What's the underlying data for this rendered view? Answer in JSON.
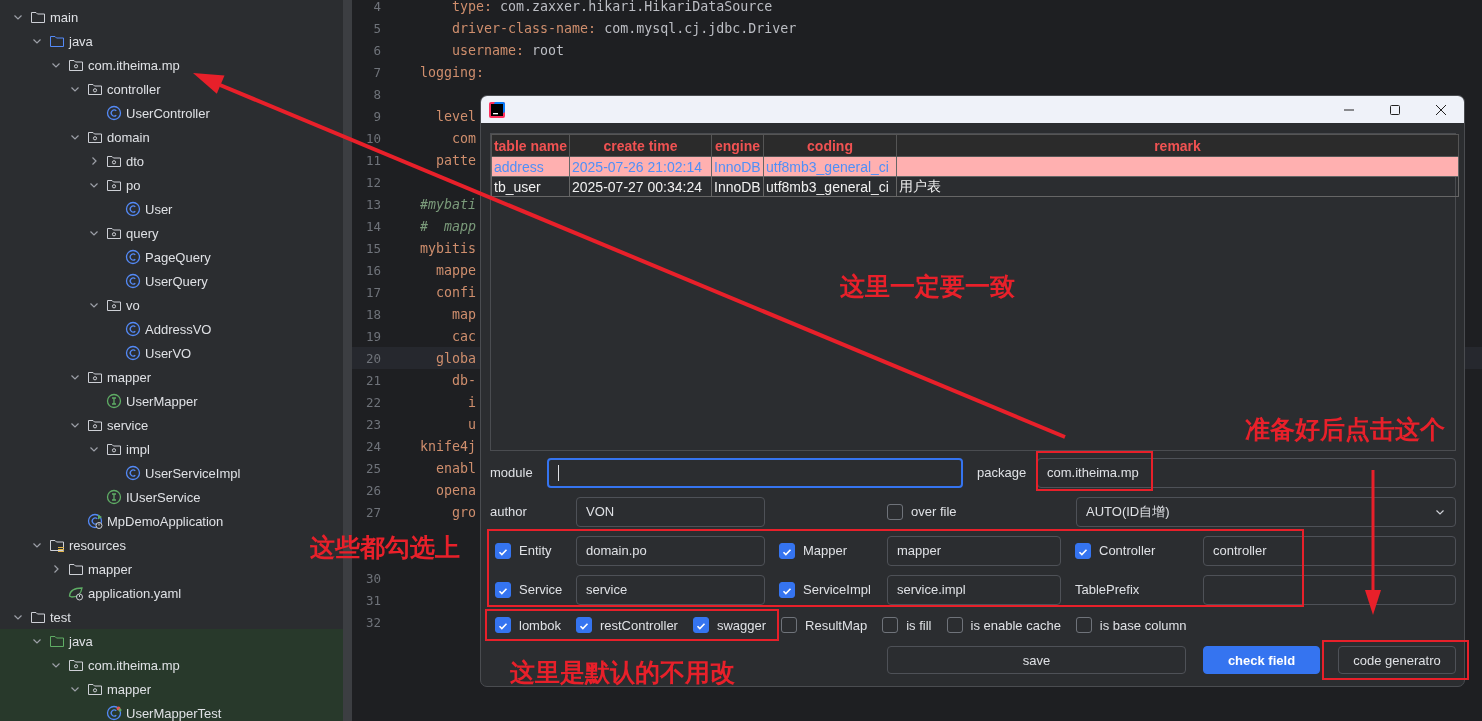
{
  "project_tree": [
    {
      "label": "main",
      "kind": "folder",
      "expanded": true,
      "highlighted": false,
      "children": [
        {
          "label": "java",
          "kind": "source-folder",
          "expanded": true,
          "highlighted": false,
          "children": [
            {
              "label": "com.itheima.mp",
              "kind": "package",
              "expanded": true,
              "highlighted": false,
              "children": [
                {
                  "label": "controller",
                  "kind": "package",
                  "expanded": true,
                  "highlighted": false,
                  "children": [
                    {
                      "label": "UserController",
                      "kind": "class",
                      "highlighted": false
                    }
                  ]
                },
                {
                  "label": "domain",
                  "kind": "package",
                  "expanded": true,
                  "highlighted": false,
                  "children": [
                    {
                      "label": "dto",
                      "kind": "package",
                      "expanded": false,
                      "highlighted": false
                    },
                    {
                      "label": "po",
                      "kind": "package",
                      "expanded": true,
                      "highlighted": false,
                      "children": [
                        {
                          "label": "User",
                          "kind": "class",
                          "highlighted": false
                        }
                      ]
                    },
                    {
                      "label": "query",
                      "kind": "package",
                      "expanded": true,
                      "highlighted": false,
                      "children": [
                        {
                          "label": "PageQuery",
                          "kind": "class",
                          "highlighted": false
                        },
                        {
                          "label": "UserQuery",
                          "kind": "class",
                          "highlighted": false
                        }
                      ]
                    },
                    {
                      "label": "vo",
                      "kind": "package",
                      "expanded": true,
                      "highlighted": false,
                      "children": [
                        {
                          "label": "AddressVO",
                          "kind": "class",
                          "highlighted": false
                        },
                        {
                          "label": "UserVO",
                          "kind": "class",
                          "highlighted": false
                        }
                      ]
                    }
                  ]
                },
                {
                  "label": "mapper",
                  "kind": "package",
                  "expanded": true,
                  "highlighted": false,
                  "children": [
                    {
                      "label": "UserMapper",
                      "kind": "interface",
                      "highlighted": false
                    }
                  ]
                },
                {
                  "label": "service",
                  "kind": "package",
                  "expanded": true,
                  "highlighted": false,
                  "children": [
                    {
                      "label": "impl",
                      "kind": "package",
                      "expanded": true,
                      "highlighted": false,
                      "children": [
                        {
                          "label": "UserServiceImpl",
                          "kind": "class",
                          "highlighted": false
                        }
                      ]
                    },
                    {
                      "label": "IUserService",
                      "kind": "interface",
                      "highlighted": false
                    }
                  ]
                },
                {
                  "label": "MpDemoApplication",
                  "kind": "app",
                  "highlighted": false
                }
              ]
            }
          ]
        },
        {
          "label": "resources",
          "kind": "resources",
          "expanded": true,
          "highlighted": false,
          "children": [
            {
              "label": "mapper",
              "kind": "folder",
              "expanded": false,
              "highlighted": false
            },
            {
              "label": "application.yaml",
              "kind": "yaml",
              "highlighted": false
            }
          ]
        }
      ]
    },
    {
      "label": "test",
      "kind": "folder",
      "expanded": true,
      "highlighted": false,
      "children": [
        {
          "label": "java",
          "kind": "test-source-folder",
          "expanded": true,
          "highlighted": true,
          "children": [
            {
              "label": "com.itheima.mp",
              "kind": "package",
              "expanded": true,
              "highlighted": true,
              "children": [
                {
                  "label": "mapper",
                  "kind": "package",
                  "expanded": true,
                  "highlighted": true,
                  "children": [
                    {
                      "label": "UserMapperTest",
                      "kind": "test-class",
                      "highlighted": true
                    }
                  ]
                }
              ]
            }
          ]
        }
      ]
    }
  ],
  "editor": {
    "lines": [
      {
        "number": "4",
        "kind": "code",
        "key": "    type:",
        "value": " com.zaxxer.hikari.HikariDataSource",
        "current": false
      },
      {
        "number": "5",
        "kind": "code",
        "key": "    driver-class-name:",
        "value": " com.mysql.cj.jdbc.Driver",
        "current": false
      },
      {
        "number": "6",
        "kind": "code",
        "key": "    username:",
        "value": " root",
        "current": false
      },
      {
        "number": "7",
        "kind": "code",
        "key": "logging:",
        "current": false
      },
      {
        "number": "8",
        "kind": "blank",
        "current": false
      },
      {
        "number": "9",
        "kind": "code",
        "key": "  level",
        "current": false
      },
      {
        "number": "10",
        "kind": "code",
        "key": "    com",
        "current": false
      },
      {
        "number": "11",
        "kind": "code",
        "key": "  patte",
        "current": false
      },
      {
        "number": "12",
        "kind": "blank",
        "current": false
      },
      {
        "number": "13",
        "kind": "comment",
        "key": "#mybati",
        "current": false
      },
      {
        "number": "14",
        "kind": "comment",
        "key": "#  mapp",
        "current": false
      },
      {
        "number": "15",
        "kind": "code",
        "key": "mybitis",
        "current": false
      },
      {
        "number": "16",
        "kind": "code",
        "key": "  mappe",
        "current": false
      },
      {
        "number": "17",
        "kind": "code",
        "key": "  confi",
        "current": false
      },
      {
        "number": "18",
        "kind": "code",
        "key": "    map",
        "current": false
      },
      {
        "number": "19",
        "kind": "code",
        "key": "    cac",
        "current": false
      },
      {
        "number": "20",
        "kind": "code",
        "key": "  globa",
        "current": true
      },
      {
        "number": "21",
        "kind": "code",
        "key": "    db-",
        "current": false
      },
      {
        "number": "22",
        "kind": "code",
        "key": "      i",
        "current": false
      },
      {
        "number": "23",
        "kind": "code",
        "key": "      u",
        "current": false
      },
      {
        "number": "24",
        "kind": "code",
        "key": "knife4j",
        "current": false
      },
      {
        "number": "25",
        "kind": "code",
        "key": "  enabl",
        "current": false
      },
      {
        "number": "26",
        "kind": "code",
        "key": "  opena",
        "current": false
      },
      {
        "number": "27",
        "kind": "code",
        "key": "    gro",
        "current": false
      },
      {
        "kind": "blank",
        "current": false
      },
      {
        "kind": "blank",
        "current": false
      },
      {
        "number": "30",
        "kind": "blank",
        "current": false
      },
      {
        "number": "31",
        "kind": "blank",
        "current": false
      },
      {
        "number": "32",
        "kind": "blank",
        "current": false
      }
    ]
  },
  "dialog": {
    "table": {
      "columns": [
        "table name",
        "create time",
        "engine",
        "coding",
        "remark"
      ],
      "rows": [
        {
          "cells": [
            "address",
            "2025-07-26 21:02:14",
            "InnoDB",
            "utf8mb3_general_ci"
          ],
          "selected": true
        },
        {
          "cells": [
            "tb_user",
            "2025-07-27 00:34:24",
            "InnoDB",
            "utf8mb3_general_ci",
            "用户表"
          ],
          "selected": false
        }
      ]
    },
    "module": {
      "label": "module",
      "focused": true
    },
    "package": {
      "label": "package",
      "value": "com.itheima.mp"
    },
    "author": {
      "label": "author",
      "value": "VON"
    },
    "over_file": {
      "label": "over file",
      "checked": false
    },
    "id_type": {
      "value": "AUTO(ID自增)"
    },
    "layers": [
      {
        "kind": "checkbox",
        "label": "Entity",
        "checked": true,
        "value": "domain.po"
      },
      {
        "kind": "checkbox",
        "label": "Mapper",
        "checked": true,
        "value": "mapper"
      },
      {
        "kind": "checkbox",
        "label": "Controller",
        "checked": true,
        "value": "controller"
      },
      {
        "kind": "checkbox",
        "label": "Service",
        "checked": true,
        "value": "service"
      },
      {
        "kind": "checkbox",
        "label": "ServiceImpl",
        "checked": true,
        "value": "service.impl"
      },
      {
        "kind": "label",
        "label": "TablePrefix"
      }
    ],
    "options": [
      {
        "label": "lombok",
        "checked": true
      },
      {
        "label": "restController",
        "checked": true
      },
      {
        "label": "swagger",
        "checked": true
      },
      {
        "label": "ResultMap",
        "checked": false
      },
      {
        "label": "is fill",
        "checked": false
      },
      {
        "label": "is enable cache",
        "checked": false
      },
      {
        "label": "is base column",
        "checked": false
      }
    ],
    "buttons": [
      {
        "label": "save",
        "kind": "secondary"
      },
      {
        "label": "check field",
        "kind": "primary"
      },
      {
        "label": "code generatro",
        "kind": "secondary"
      }
    ]
  },
  "annotations": [
    {
      "text": "这里一定要一致"
    },
    {
      "text": "准备好后点击这个"
    },
    {
      "text": "这些都勾选上"
    },
    {
      "text": "这里是默认的不用改"
    }
  ]
}
